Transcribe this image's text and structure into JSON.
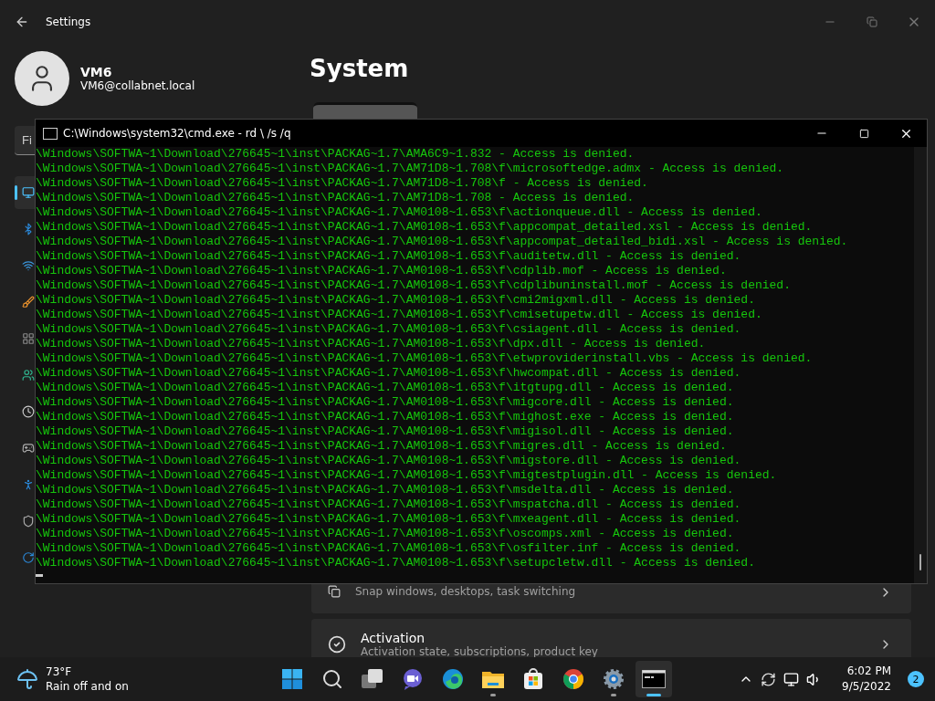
{
  "settings": {
    "title": "Settings",
    "user": {
      "name": "VM6",
      "email": "VM6@collabnet.local"
    },
    "search": {
      "placeholder": "Fi"
    },
    "nav": [
      {
        "selected": true
      },
      {
        "selected": false
      },
      {
        "selected": false
      },
      {
        "selected": false
      },
      {
        "selected": false
      },
      {
        "selected": false
      },
      {
        "selected": false
      },
      {
        "selected": false
      },
      {
        "selected": false
      },
      {
        "selected": false
      },
      {
        "selected": false
      }
    ],
    "page_title": "System",
    "cards": [
      {
        "kind": "multitasking",
        "subtitle": "Snap windows, desktops, task switching"
      },
      {
        "kind": "activation",
        "title": "Activation",
        "subtitle": "Activation state, subscriptions, product key"
      }
    ]
  },
  "cmd": {
    "title": "C:\\Windows\\system32\\cmd.exe - rd \\ /s /q",
    "lines": [
      "\\Windows\\SOFTWA~1\\Download\\276645~1\\inst\\PACKAG~1.7\\AMA6C9~1.832 - Access is denied.",
      "\\Windows\\SOFTWA~1\\Download\\276645~1\\inst\\PACKAG~1.7\\AM71D8~1.708\\f\\microsoftedge.admx - Access is denied.",
      "\\Windows\\SOFTWA~1\\Download\\276645~1\\inst\\PACKAG~1.7\\AM71D8~1.708\\f - Access is denied.",
      "\\Windows\\SOFTWA~1\\Download\\276645~1\\inst\\PACKAG~1.7\\AM71D8~1.708 - Access is denied.",
      "\\Windows\\SOFTWA~1\\Download\\276645~1\\inst\\PACKAG~1.7\\AM0108~1.653\\f\\actionqueue.dll - Access is denied.",
      "\\Windows\\SOFTWA~1\\Download\\276645~1\\inst\\PACKAG~1.7\\AM0108~1.653\\f\\appcompat_detailed.xsl - Access is denied.",
      "\\Windows\\SOFTWA~1\\Download\\276645~1\\inst\\PACKAG~1.7\\AM0108~1.653\\f\\appcompat_detailed_bidi.xsl - Access is denied.",
      "\\Windows\\SOFTWA~1\\Download\\276645~1\\inst\\PACKAG~1.7\\AM0108~1.653\\f\\auditetw.dll - Access is denied.",
      "\\Windows\\SOFTWA~1\\Download\\276645~1\\inst\\PACKAG~1.7\\AM0108~1.653\\f\\cdplib.mof - Access is denied.",
      "\\Windows\\SOFTWA~1\\Download\\276645~1\\inst\\PACKAG~1.7\\AM0108~1.653\\f\\cdplibuninstall.mof - Access is denied.",
      "\\Windows\\SOFTWA~1\\Download\\276645~1\\inst\\PACKAG~1.7\\AM0108~1.653\\f\\cmi2migxml.dll - Access is denied.",
      "\\Windows\\SOFTWA~1\\Download\\276645~1\\inst\\PACKAG~1.7\\AM0108~1.653\\f\\cmisetupetw.dll - Access is denied.",
      "\\Windows\\SOFTWA~1\\Download\\276645~1\\inst\\PACKAG~1.7\\AM0108~1.653\\f\\csiagent.dll - Access is denied.",
      "\\Windows\\SOFTWA~1\\Download\\276645~1\\inst\\PACKAG~1.7\\AM0108~1.653\\f\\dpx.dll - Access is denied.",
      "\\Windows\\SOFTWA~1\\Download\\276645~1\\inst\\PACKAG~1.7\\AM0108~1.653\\f\\etwproviderinstall.vbs - Access is denied.",
      "\\Windows\\SOFTWA~1\\Download\\276645~1\\inst\\PACKAG~1.7\\AM0108~1.653\\f\\hwcompat.dll - Access is denied.",
      "\\Windows\\SOFTWA~1\\Download\\276645~1\\inst\\PACKAG~1.7\\AM0108~1.653\\f\\itgtupg.dll - Access is denied.",
      "\\Windows\\SOFTWA~1\\Download\\276645~1\\inst\\PACKAG~1.7\\AM0108~1.653\\f\\migcore.dll - Access is denied.",
      "\\Windows\\SOFTWA~1\\Download\\276645~1\\inst\\PACKAG~1.7\\AM0108~1.653\\f\\mighost.exe - Access is denied.",
      "\\Windows\\SOFTWA~1\\Download\\276645~1\\inst\\PACKAG~1.7\\AM0108~1.653\\f\\migisol.dll - Access is denied.",
      "\\Windows\\SOFTWA~1\\Download\\276645~1\\inst\\PACKAG~1.7\\AM0108~1.653\\f\\migres.dll - Access is denied.",
      "\\Windows\\SOFTWA~1\\Download\\276645~1\\inst\\PACKAG~1.7\\AM0108~1.653\\f\\migstore.dll - Access is denied.",
      "\\Windows\\SOFTWA~1\\Download\\276645~1\\inst\\PACKAG~1.7\\AM0108~1.653\\f\\migtestplugin.dll - Access is denied.",
      "\\Windows\\SOFTWA~1\\Download\\276645~1\\inst\\PACKAG~1.7\\AM0108~1.653\\f\\msdelta.dll - Access is denied.",
      "\\Windows\\SOFTWA~1\\Download\\276645~1\\inst\\PACKAG~1.7\\AM0108~1.653\\f\\mspatcha.dll - Access is denied.",
      "\\Windows\\SOFTWA~1\\Download\\276645~1\\inst\\PACKAG~1.7\\AM0108~1.653\\f\\mxeagent.dll - Access is denied.",
      "\\Windows\\SOFTWA~1\\Download\\276645~1\\inst\\PACKAG~1.7\\AM0108~1.653\\f\\oscomps.xml - Access is denied.",
      "\\Windows\\SOFTWA~1\\Download\\276645~1\\inst\\PACKAG~1.7\\AM0108~1.653\\f\\osfilter.inf - Access is denied.",
      "\\Windows\\SOFTWA~1\\Download\\276645~1\\inst\\PACKAG~1.7\\AM0108~1.653\\f\\setupcletw.dll - Access is denied."
    ]
  },
  "taskbar": {
    "weather": {
      "temperature": "73°F",
      "condition": "Rain off and on"
    },
    "apps": [
      {
        "kind": "start",
        "running": false,
        "active": false
      },
      {
        "kind": "search",
        "running": false,
        "active": false
      },
      {
        "kind": "taskview",
        "running": false,
        "active": false
      },
      {
        "kind": "chat",
        "running": false,
        "active": false
      },
      {
        "kind": "edge",
        "running": false,
        "active": false
      },
      {
        "kind": "explorer",
        "running": true,
        "active": false
      },
      {
        "kind": "store",
        "running": false,
        "active": false
      },
      {
        "kind": "chrome",
        "running": false,
        "active": false
      },
      {
        "kind": "settings",
        "running": true,
        "active": false
      },
      {
        "kind": "terminal",
        "running": true,
        "active": true
      }
    ],
    "time": "6:02 PM",
    "date": "9/5/2022",
    "notifications": "2"
  }
}
